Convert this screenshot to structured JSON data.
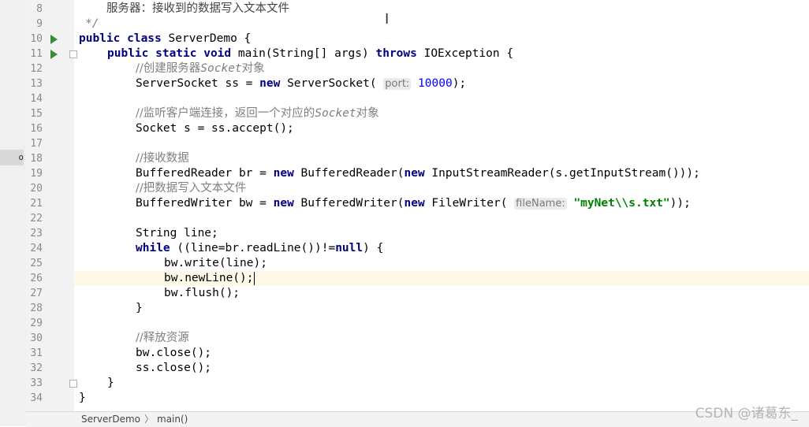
{
  "editor": {
    "lines": [
      {
        "num": "8",
        "text": "服务器：接收到的数据写入文本文件"
      },
      {
        "num": "9",
        "text": "*/"
      },
      {
        "num": "10",
        "text": "public class ServerDemo {"
      },
      {
        "num": "11",
        "text": "public static void main(String[] args) throws IOException {"
      },
      {
        "num": "12",
        "text": "//创建服务器Socket对象"
      },
      {
        "num": "13",
        "text": "ServerSocket ss = new ServerSocket( port: 10000);"
      },
      {
        "num": "14",
        "text": ""
      },
      {
        "num": "15",
        "text": "//监听客户端连接，返回一个对应的Socket对象"
      },
      {
        "num": "16",
        "text": "Socket s = ss.accept();"
      },
      {
        "num": "17",
        "text": ""
      },
      {
        "num": "18",
        "text": "//接收数据"
      },
      {
        "num": "19",
        "text": "BufferedReader br = new BufferedReader(new InputStreamReader(s.getInputStream()));"
      },
      {
        "num": "20",
        "text": "//把数据写入文本文件"
      },
      {
        "num": "21",
        "text": "BufferedWriter bw = new BufferedWriter(new FileWriter( fileName: \"myNet\\\\s.txt\"));"
      },
      {
        "num": "22",
        "text": ""
      },
      {
        "num": "23",
        "text": "String line;"
      },
      {
        "num": "24",
        "text": "while ((line=br.readLine())!=null) {"
      },
      {
        "num": "25",
        "text": "bw.write(line);"
      },
      {
        "num": "26",
        "text": "bw.newLine();"
      },
      {
        "num": "27",
        "text": "bw.flush();"
      },
      {
        "num": "28",
        "text": "}"
      },
      {
        "num": "29",
        "text": ""
      },
      {
        "num": "30",
        "text": "//释放资源"
      },
      {
        "num": "31",
        "text": "bw.close();"
      },
      {
        "num": "32",
        "text": "ss.close();"
      },
      {
        "num": "33",
        "text": "}"
      },
      {
        "num": "34",
        "text": "}"
      }
    ],
    "current_line": "26",
    "colors": {
      "keyword": "#000080",
      "comment": "#808080",
      "string": "#008000",
      "number": "#0000ff",
      "current_line_bg": "#fcfae7",
      "gutter_bg": "#f2f2f2",
      "run_icon": "#3c8a3c"
    },
    "icons": [
      "run-icon",
      "fold-icon"
    ]
  },
  "statusbar": {
    "breadcrumb": [
      "ServerDemo",
      "main()"
    ],
    "separator": "〉"
  },
  "left_panel": {
    "tab_label": "o"
  },
  "watermark": "CSDN @诸葛东_"
}
